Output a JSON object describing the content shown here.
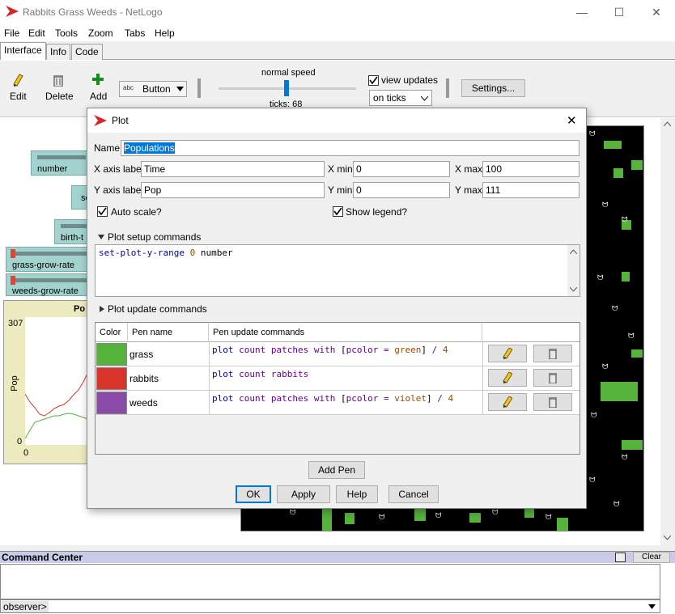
{
  "window": {
    "title": "Rabbits Grass Weeds - NetLogo",
    "minimize_glyph": "—",
    "maximize_glyph": "☐",
    "close_glyph": "✕"
  },
  "menu": [
    "File",
    "Edit",
    "Tools",
    "Zoom",
    "Tabs",
    "Help"
  ],
  "tabs": [
    "Interface",
    "Info",
    "Code"
  ],
  "toolbar": {
    "edit": "Edit",
    "delete": "Delete",
    "add": "Add",
    "widget_type": "Button",
    "widget_icon_text": "abc",
    "speed_label": "normal speed",
    "ticks_label": "ticks: 68",
    "view_updates": "view updates",
    "update_mode": "on ticks",
    "settings": "Settings..."
  },
  "model": {
    "slider_number": "number",
    "slider_birth": "birth-t",
    "slider_se": "se",
    "slider_grass": "grass-grow-rate",
    "slider_weeds": "weeds-grow-rate",
    "plot_title": "Po",
    "plot_ymax": "307",
    "plot_ymin": "0",
    "plot_xmin": "0",
    "plot_ylabel": "Pop"
  },
  "dialog": {
    "title": "Plot",
    "close_glyph": "✕",
    "name_label": "Name",
    "name_value": "Populations",
    "x_axis_label": "X axis label",
    "x_axis_value": "Time",
    "x_min_label": "X min",
    "x_min_value": "0",
    "x_max_label": "X max",
    "x_max_value": "100",
    "y_axis_label": "Y axis label",
    "y_axis_value": "Pop",
    "y_min_label": "Y min",
    "y_min_value": "0",
    "y_max_label": "Y max",
    "y_max_value": "111",
    "auto_scale": "Auto scale?",
    "show_legend": "Show legend?",
    "setup_header": "Plot setup commands",
    "setup_code": {
      "cmd": "set-plot-y-range",
      "num": "0",
      "var": "number"
    },
    "update_header": "Plot update commands",
    "table_headers": {
      "color": "Color",
      "pen_name": "Pen name",
      "pen_update": "Pen update commands"
    },
    "pens": [
      {
        "name": "grass",
        "color": "#55b33c",
        "code": {
          "cmd": "plot",
          "kw": "count patches with",
          "b1": "[",
          "var": "pcolor",
          "eq": "=",
          "val": "green",
          "b2": "]",
          "op": "/",
          "num": "4"
        }
      },
      {
        "name": "rabbits",
        "color": "#d9342b",
        "code": {
          "cmd": "plot",
          "kw": "count rabbits"
        }
      },
      {
        "name": "weeds",
        "color": "#8a4ba8",
        "code": {
          "cmd": "plot",
          "kw": "count patches with",
          "b1": "[",
          "var": "pcolor",
          "eq": "=",
          "val": "violet",
          "b2": "]",
          "op": "/",
          "num": "4"
        }
      }
    ],
    "add_pen": "Add Pen",
    "ok": "OK",
    "apply": "Apply",
    "help": "Help",
    "cancel": "Cancel"
  },
  "command_center": {
    "title": "Command Center",
    "clear": "Clear",
    "prompt": "observer>"
  },
  "colors": {
    "accent": "#0078d7",
    "netlogo_red": "#d9252a",
    "slider_teal": "#a3d3ce",
    "world_bg": "#000000",
    "grass_patch": "#55b33c"
  }
}
